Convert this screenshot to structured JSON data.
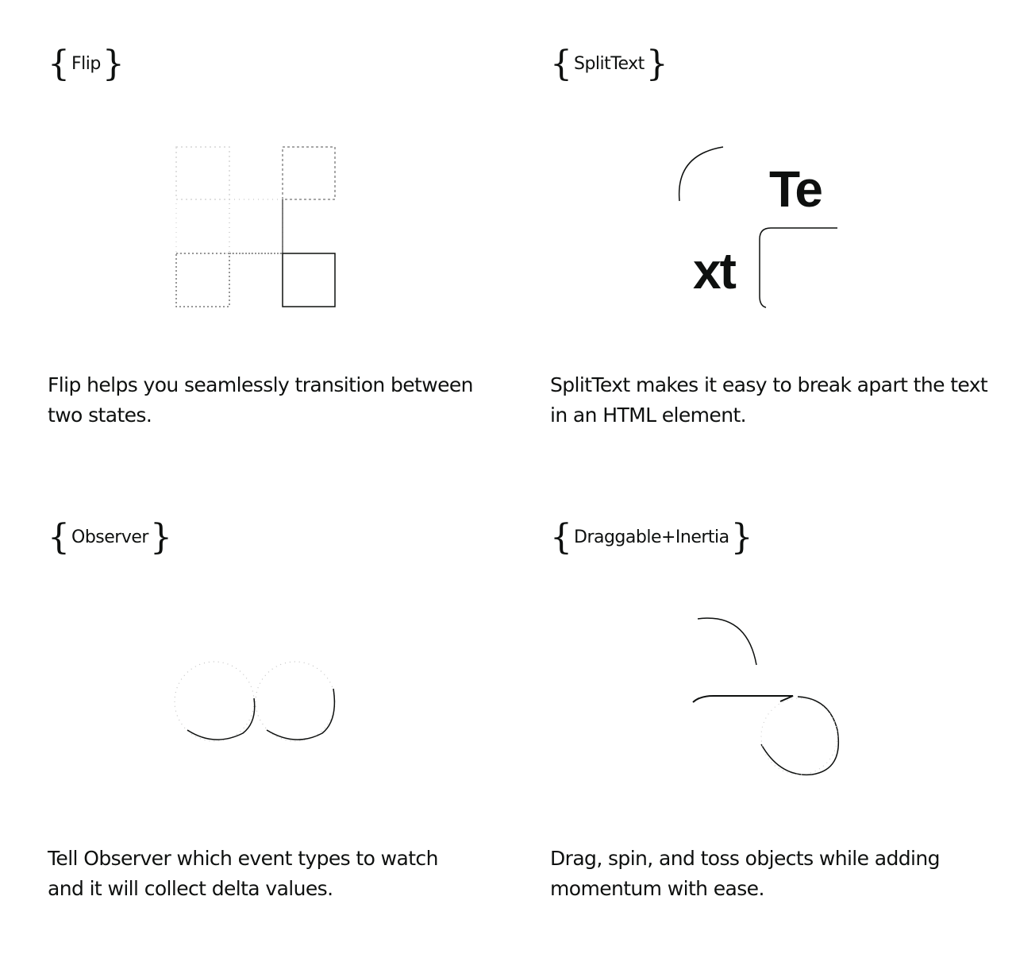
{
  "cards": [
    {
      "tag": "Flip",
      "description": "Flip helps you seamlessly transition between two states."
    },
    {
      "tag": "SplitText",
      "description": "SplitText makes it easy to break apart the text in an HTML element.",
      "split_top": "Te",
      "split_bottom": "xt"
    },
    {
      "tag": "Observer",
      "description": "Tell Observer which event types to watch and it will collect delta values."
    },
    {
      "tag": "Draggable+Inertia",
      "description": "Drag, spin, and toss objects while adding momentum with ease."
    }
  ],
  "braces": {
    "open": "{",
    "close": "}"
  },
  "colors": {
    "ink": "#0e100f",
    "background": "#ffffff",
    "faint": "#b8b8b8"
  }
}
